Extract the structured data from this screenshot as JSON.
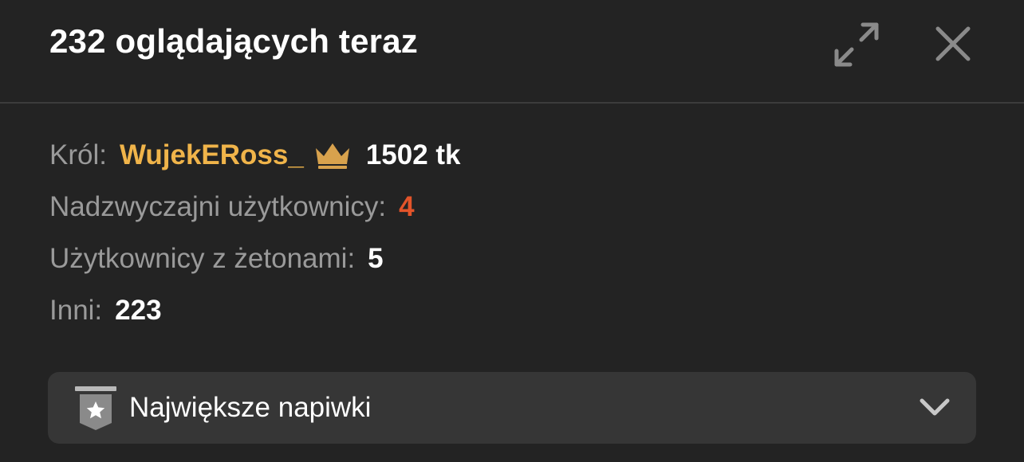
{
  "header": {
    "title": "232 oglądających teraz",
    "expand_icon": "expand-icon",
    "close_icon": "close-icon"
  },
  "stats": {
    "king": {
      "label": "Król:",
      "username": "WujekERoss_",
      "icon": "crown-icon",
      "tokens": "1502 tk"
    },
    "special_users": {
      "label": "Nadzwyczajni użytkownicy:",
      "value": "4"
    },
    "token_users": {
      "label": "Użytkownicy z żetonami:",
      "value": "5"
    },
    "others": {
      "label": "Inni:",
      "value": "223"
    }
  },
  "dropdown": {
    "label": "Największe napiwki",
    "icon": "star-badge-icon",
    "chevron": "chevron-down-icon"
  },
  "colors": {
    "background": "#232323",
    "dropdown_bg": "#363636",
    "label": "#9a9a9a",
    "king_name": "#f0b44a",
    "special_count": "#e3542a",
    "icon_gray": "#8a8a8a"
  }
}
